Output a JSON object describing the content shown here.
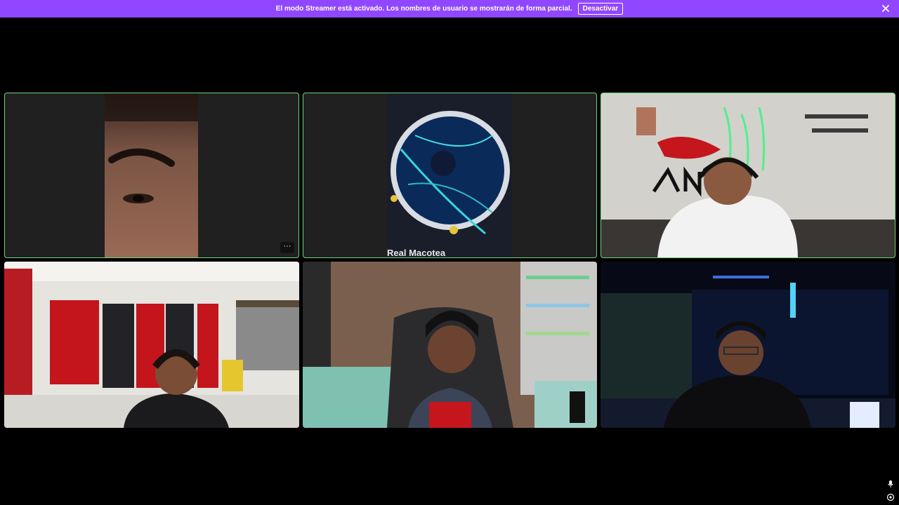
{
  "banner": {
    "message": "El modo Streamer está activado. Los nombres de usuario se mostrarán de forma parcial.",
    "button_label": "Desactivar",
    "close_icon": "close-icon",
    "color": "#9147ff"
  },
  "grid": {
    "speaking_border_color": "#6fd37a",
    "tiles": [
      {
        "id": "tile-1",
        "speaking": true,
        "more_icon": "more-options-icon",
        "more_label": "···"
      },
      {
        "id": "tile-2",
        "speaking": true,
        "overlay_text": "Real Macotea"
      },
      {
        "id": "tile-3",
        "speaking": true
      },
      {
        "id": "tile-4",
        "speaking": false
      },
      {
        "id": "tile-5",
        "speaking": false
      },
      {
        "id": "tile-6",
        "speaking": false
      }
    ]
  },
  "corner_controls": {
    "mic_icon": "microphone-icon",
    "target_icon": "target-icon"
  }
}
